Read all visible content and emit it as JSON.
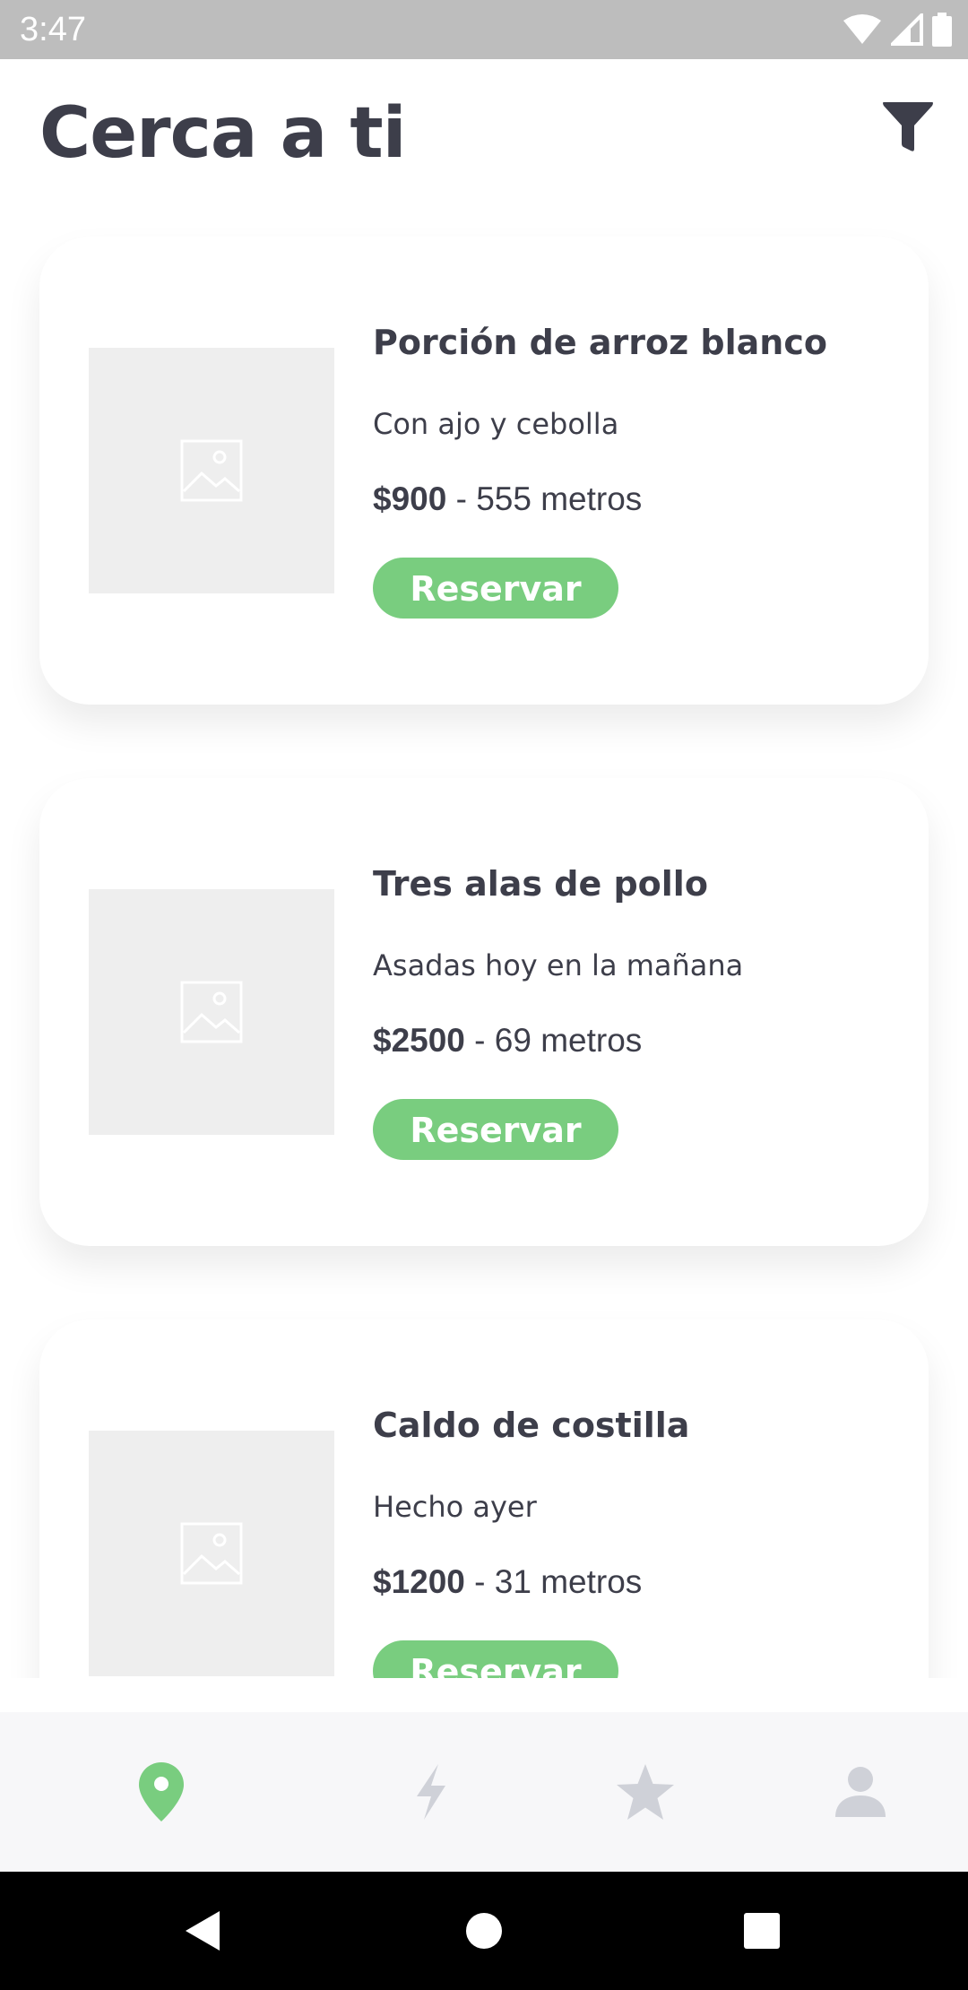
{
  "status_bar": {
    "time": "3:47",
    "icons": [
      "wifi-icon",
      "signal-icon",
      "battery-icon"
    ]
  },
  "header": {
    "title": "Cerca a ti",
    "filter_icon": "filter-icon"
  },
  "items": [
    {
      "name": "Porción de arroz blanco",
      "description": "Con ajo y cebolla",
      "price": "$900",
      "distance": " - 555 metros",
      "button": "Reservar"
    },
    {
      "name": "Tres alas de pollo",
      "description": "Asadas hoy en la mañana",
      "price": "$2500",
      "distance": " - 69 metros",
      "button": "Reservar"
    },
    {
      "name": "Caldo de costilla",
      "description": "Hecho ayer",
      "price": "$1200",
      "distance": " - 31 metros",
      "button": "Reservar"
    }
  ],
  "bottom_nav": {
    "items": [
      {
        "icon": "location-pin-icon",
        "active": true
      },
      {
        "icon": "lightning-icon",
        "active": false
      },
      {
        "icon": "star-icon",
        "active": false
      },
      {
        "icon": "person-icon",
        "active": false
      }
    ]
  },
  "system_nav": [
    "back-icon",
    "home-icon",
    "recents-icon"
  ],
  "colors": {
    "accent_green": "#79cd7f",
    "title_text": "#3d3e4a",
    "inactive_icon": "#cfd1d8",
    "placeholder_bg": "#eeeeee",
    "status_bar": "#bdbdbd"
  }
}
